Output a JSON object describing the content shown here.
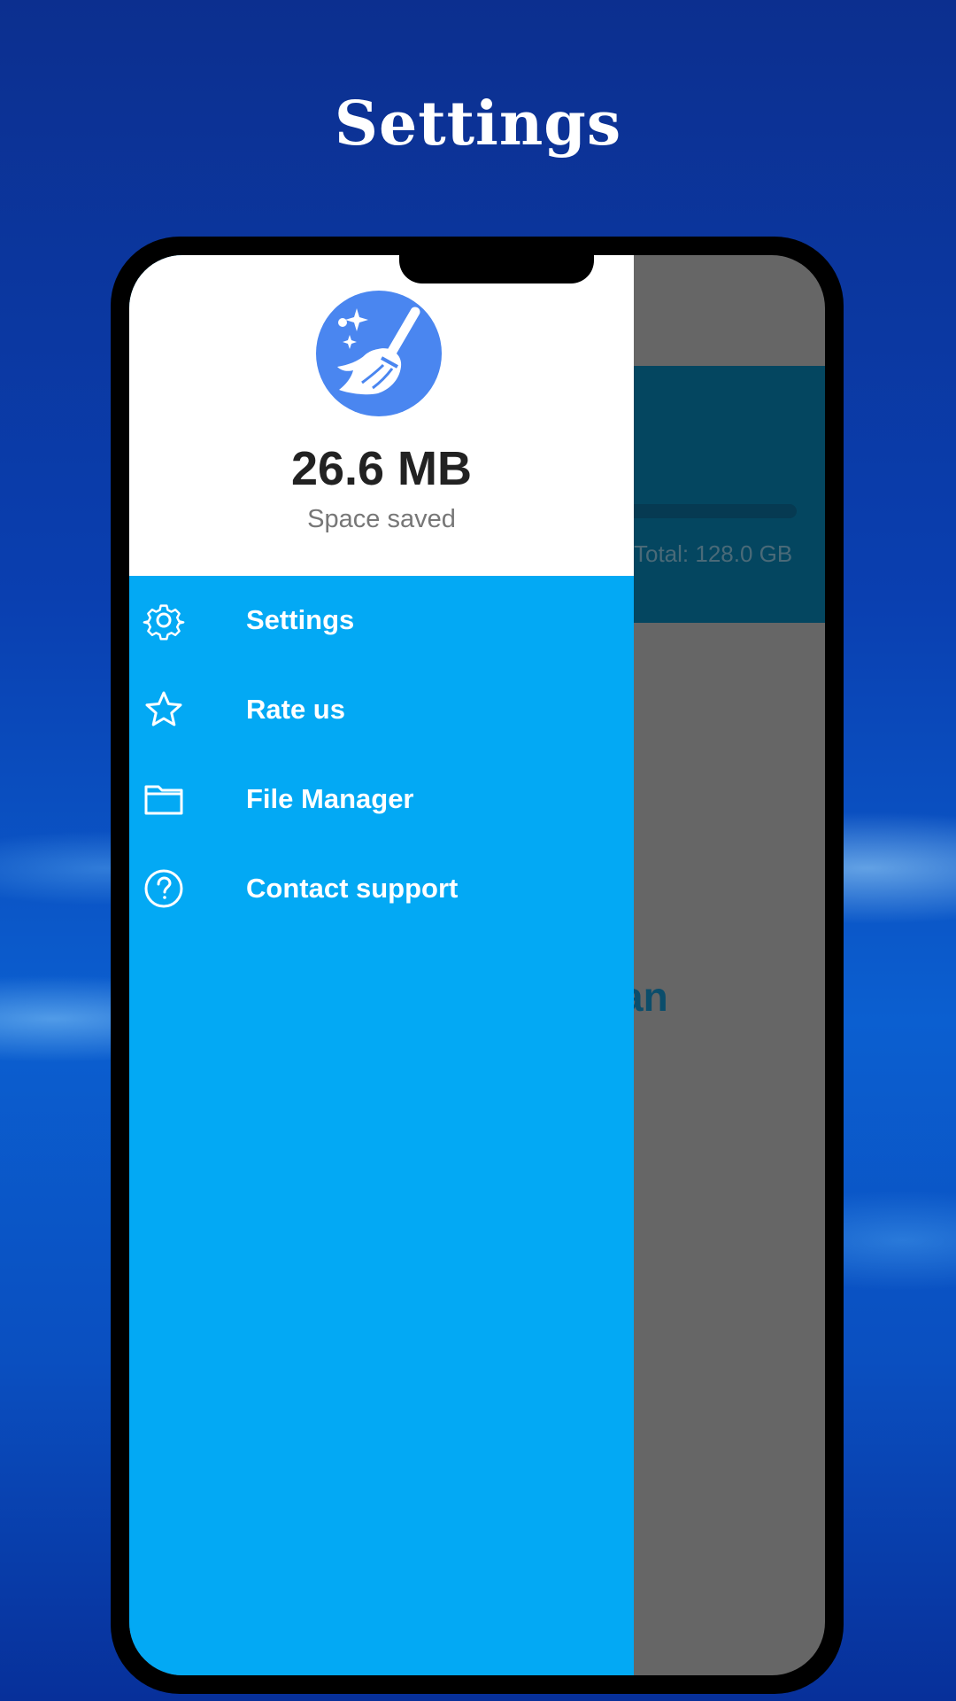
{
  "promo": {
    "headline": "Settings"
  },
  "background_app": {
    "storage_total": "Total: 128.0 GB",
    "partial_button_text": "an"
  },
  "drawer": {
    "header": {
      "icon": "broom-cleaner-icon",
      "saved_value": "26.6 MB",
      "saved_label": "Space saved"
    },
    "items": [
      {
        "label": "Settings",
        "icon": "gear-icon"
      },
      {
        "label": "Rate us",
        "icon": "star-icon"
      },
      {
        "label": "File Manager",
        "icon": "folder-icon"
      },
      {
        "label": "Contact support",
        "icon": "help-circle-icon"
      }
    ]
  },
  "colors": {
    "drawer_background": "#03a9f4",
    "header_background": "#ffffff",
    "app_icon_background": "#4a86f0",
    "scrim": "#666666"
  }
}
